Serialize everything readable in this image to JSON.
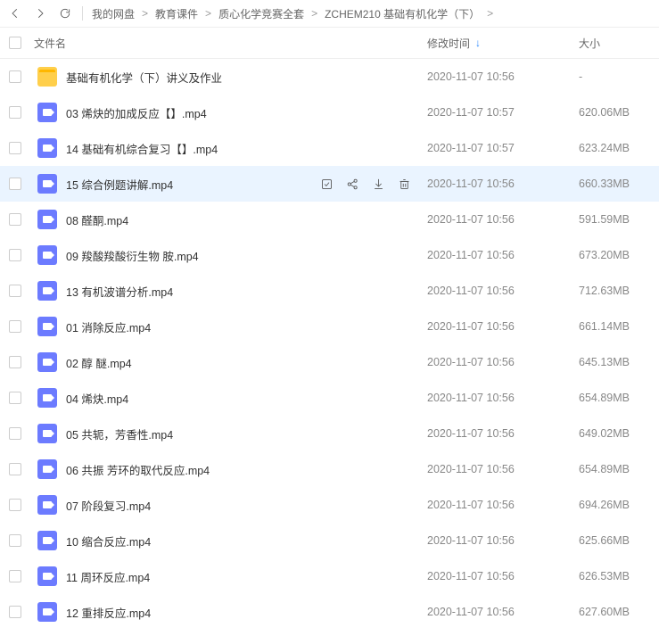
{
  "breadcrumb": {
    "items": [
      {
        "label": "我的网盘"
      },
      {
        "label": "教育课件"
      },
      {
        "label": "质心化学竞赛全套"
      },
      {
        "label": "ZCHEM210 基础有机化学（下）"
      }
    ]
  },
  "columns": {
    "name": "文件名",
    "time": "修改时间",
    "size": "大小"
  },
  "hover_index": 3,
  "files": [
    {
      "type": "folder",
      "name": "基础有机化学（下）讲义及作业",
      "time": "2020-11-07 10:56",
      "size": "-"
    },
    {
      "type": "video",
      "name": "03 烯炔的加成反应【】.mp4",
      "time": "2020-11-07 10:57",
      "size": "620.06MB"
    },
    {
      "type": "video",
      "name": "14 基础有机综合复习【】.mp4",
      "time": "2020-11-07 10:57",
      "size": "623.24MB"
    },
    {
      "type": "video",
      "name": "15 综合例题讲解.mp4",
      "time": "2020-11-07 10:56",
      "size": "660.33MB"
    },
    {
      "type": "video",
      "name": "08 醛酮.mp4",
      "time": "2020-11-07 10:56",
      "size": "591.59MB"
    },
    {
      "type": "video",
      "name": "09 羧酸羧酸衍生物 胺.mp4",
      "time": "2020-11-07 10:56",
      "size": "673.20MB"
    },
    {
      "type": "video",
      "name": "13 有机波谱分析.mp4",
      "time": "2020-11-07 10:56",
      "size": "712.63MB"
    },
    {
      "type": "video",
      "name": "01 消除反应.mp4",
      "time": "2020-11-07 10:56",
      "size": "661.14MB"
    },
    {
      "type": "video",
      "name": "02 醇 醚.mp4",
      "time": "2020-11-07 10:56",
      "size": "645.13MB"
    },
    {
      "type": "video",
      "name": "04 烯炔.mp4",
      "time": "2020-11-07 10:56",
      "size": "654.89MB"
    },
    {
      "type": "video",
      "name": "05 共轭，芳香性.mp4",
      "time": "2020-11-07 10:56",
      "size": "649.02MB"
    },
    {
      "type": "video",
      "name": "06 共振 芳环的取代反应.mp4",
      "time": "2020-11-07 10:56",
      "size": "654.89MB"
    },
    {
      "type": "video",
      "name": "07 阶段复习.mp4",
      "time": "2020-11-07 10:56",
      "size": "694.26MB"
    },
    {
      "type": "video",
      "name": "10 缩合反应.mp4",
      "time": "2020-11-07 10:56",
      "size": "625.66MB"
    },
    {
      "type": "video",
      "name": "11 周环反应.mp4",
      "time": "2020-11-07 10:56",
      "size": "626.53MB"
    },
    {
      "type": "video",
      "name": "12 重排反应.mp4",
      "time": "2020-11-07 10:56",
      "size": "627.60MB"
    }
  ]
}
